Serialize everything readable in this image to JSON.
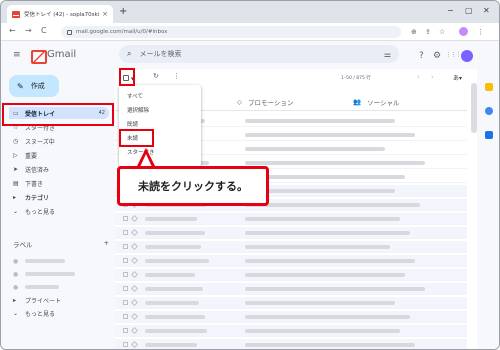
{
  "browser": {
    "tab_title": "受信トレイ (42) - sopla70ski33@...",
    "tab_close": "×",
    "new_tab": "+",
    "url": "mail.google.com/mail/u/0/#inbox",
    "win_min": "−",
    "win_max": "▢",
    "win_close": "✕",
    "back": "←",
    "forward": "→",
    "reload": "C"
  },
  "header": {
    "menu_icon": "≡",
    "logo_text": "Gmail",
    "search_icon": "⌕",
    "search_placeholder": "メールを検索",
    "filter_icon": "⚌",
    "help_icon": "?",
    "settings_icon": "⚙",
    "apps_icon": "⋮⋮⋮"
  },
  "sidebar": {
    "compose_icon": "✎",
    "compose_label": "作成",
    "items": [
      {
        "icon": "▭",
        "label": "受信トレイ",
        "count": "42"
      },
      {
        "icon": "☆",
        "label": "スター付き",
        "count": ""
      },
      {
        "icon": "◷",
        "label": "スヌーズ中",
        "count": ""
      },
      {
        "icon": "▷",
        "label": "重要",
        "count": ""
      },
      {
        "icon": "➤",
        "label": "送信済み",
        "count": ""
      },
      {
        "icon": "▤",
        "label": "下書き",
        "count": ""
      },
      {
        "icon": "▸",
        "label": "カテゴリ",
        "count": ""
      },
      {
        "icon": "⌄",
        "label": "もっと見る",
        "count": ""
      }
    ],
    "labels_heading": "ラベル",
    "labels_add": "+",
    "label_items": [
      {
        "icon": "●",
        "label": "",
        "count": ""
      },
      {
        "icon": "●",
        "label": "",
        "count": ""
      },
      {
        "icon": "●",
        "label": "",
        "count": ""
      },
      {
        "icon": "▸",
        "label": "プライベート",
        "count": ""
      },
      {
        "icon": "⌄",
        "label": "もっと見る",
        "count": ""
      }
    ]
  },
  "toolbar": {
    "caret": "▼",
    "refresh_icon": "↻",
    "more_icon": "⋮",
    "pager": "1–50 / 875 行",
    "prev": "‹",
    "next": "›",
    "lang": "あ▾"
  },
  "tabs": [
    {
      "icon": "◇",
      "label": "プロモーション"
    },
    {
      "icon": "👥",
      "label": "ソーシャル"
    }
  ],
  "select_menu": {
    "items": [
      "すべて",
      "選択解除",
      "既読",
      "未読",
      "スター付き"
    ]
  },
  "callout": {
    "text": "未読をクリックする。"
  },
  "colors": {
    "highlight": "#e60012",
    "compose_bg": "#c2e7ff",
    "active_nav_bg": "#d3e3fd"
  }
}
